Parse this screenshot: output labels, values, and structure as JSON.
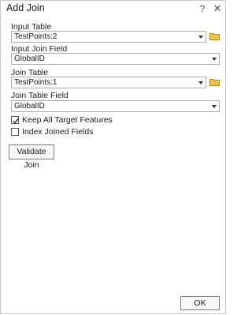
{
  "window": {
    "title": "Add Join",
    "help_glyph": "?",
    "close_glyph": "✕"
  },
  "form": {
    "input_table": {
      "label": "Input Table",
      "value": "TestPoints:2"
    },
    "input_join_field": {
      "label": "Input Join Field",
      "value": "GlobalID"
    },
    "join_table": {
      "label": "Join Table",
      "value": "TestPoints:1"
    },
    "join_table_field": {
      "label": "Join Table Field",
      "value": "GlobalID"
    },
    "keep_all": {
      "label": "Keep All Target Features",
      "checked": true
    },
    "index_joined": {
      "label": "Index Joined Fields",
      "checked": false
    }
  },
  "buttons": {
    "validate": "Validate Join",
    "ok": "OK"
  },
  "colors": {
    "folder_fill": "#e8c25a",
    "folder_stroke": "#b58a1e",
    "border": "#adadad"
  },
  "icons": [
    "help-icon",
    "close-icon",
    "folder-icon",
    "chevron-down-icon",
    "checkmark-icon"
  ]
}
